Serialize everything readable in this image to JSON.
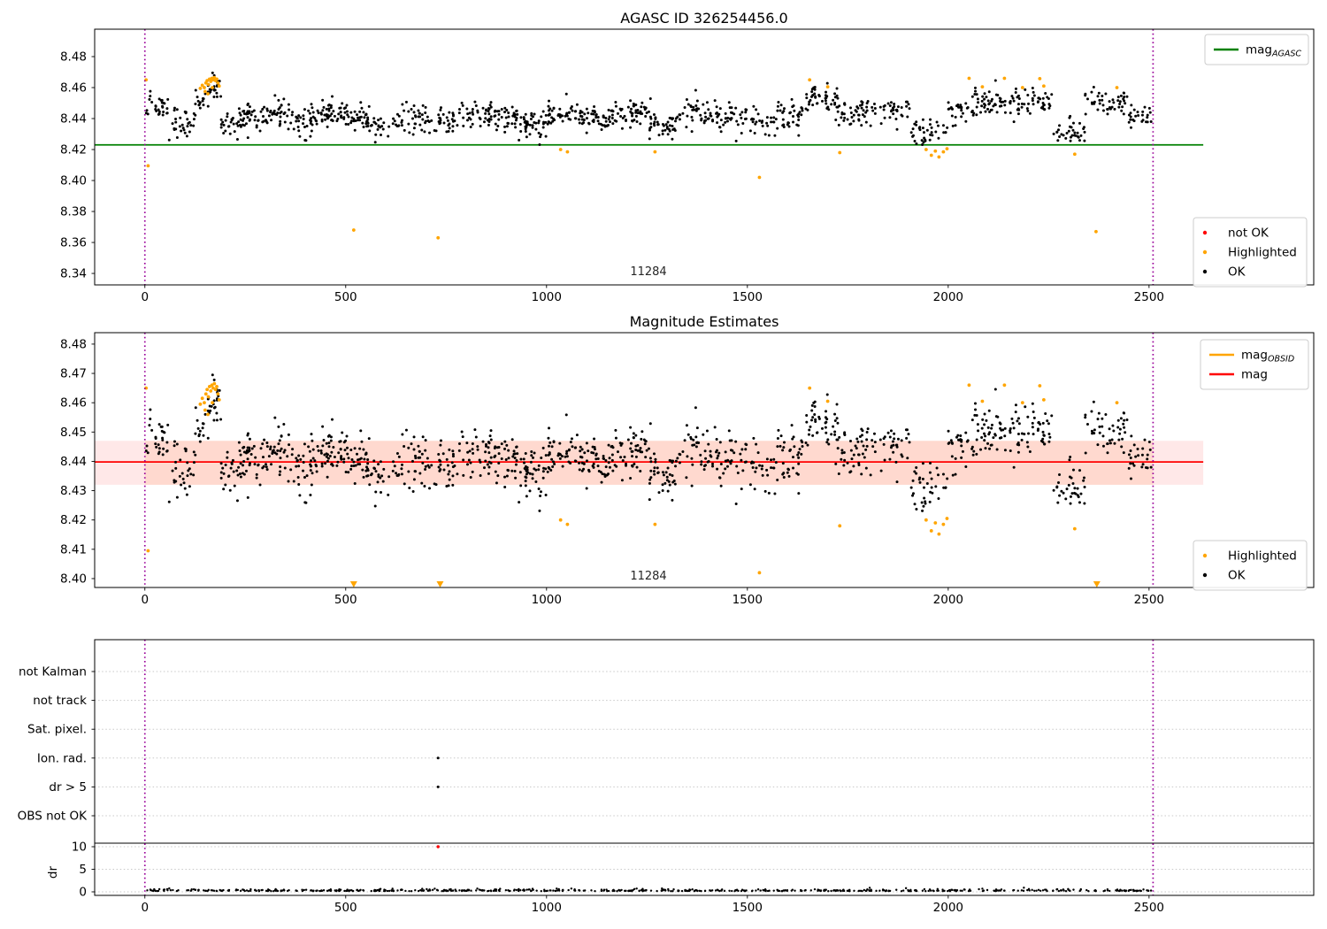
{
  "figure": {
    "background": "#ffffff"
  },
  "obsid_label": "11284",
  "colors": {
    "ok_marker": "#000000",
    "highlighted_marker": "#ffa500",
    "not_ok_marker": "#ff0000",
    "mag_agasc_line": "#008000",
    "mag_line": "#ff0000",
    "mag_band_fill": "#ff6666",
    "mag_band_inner_fill": "#ff8c50",
    "obsid_vline": "#990099",
    "grid_line": "#c8c8c8",
    "legend_border": "#cccccc"
  },
  "series_spec": {
    "seed": 1337,
    "n": 1300,
    "x_min": 2,
    "x_max": 2506,
    "noise_sd": 0.0045,
    "y_clamp": [
      8.417,
      8.4695
    ],
    "mean_profile": [
      [
        0,
        25,
        8.452
      ],
      [
        25,
        60,
        8.445
      ],
      [
        60,
        125,
        8.438
      ],
      [
        125,
        150,
        8.45
      ],
      [
        150,
        190,
        8.46
      ],
      [
        190,
        235,
        8.437
      ],
      [
        235,
        300,
        8.441
      ],
      [
        300,
        370,
        8.444
      ],
      [
        370,
        430,
        8.438
      ],
      [
        430,
        500,
        8.444
      ],
      [
        500,
        560,
        8.44
      ],
      [
        560,
        640,
        8.436
      ],
      [
        640,
        700,
        8.441
      ],
      [
        700,
        780,
        8.438
      ],
      [
        780,
        860,
        8.444
      ],
      [
        860,
        930,
        8.44
      ],
      [
        930,
        1000,
        8.436
      ],
      [
        1000,
        1080,
        8.443
      ],
      [
        1080,
        1160,
        8.44
      ],
      [
        1160,
        1250,
        8.443
      ],
      [
        1250,
        1330,
        8.437
      ],
      [
        1330,
        1420,
        8.444
      ],
      [
        1420,
        1500,
        8.44
      ],
      [
        1500,
        1575,
        8.437
      ],
      [
        1575,
        1640,
        8.442
      ],
      [
        1640,
        1725,
        8.452
      ],
      [
        1725,
        1810,
        8.443
      ],
      [
        1810,
        1905,
        8.446
      ],
      [
        1905,
        2000,
        8.432
      ],
      [
        2000,
        2065,
        8.446
      ],
      [
        2065,
        2260,
        8.451
      ],
      [
        2260,
        2340,
        8.431
      ],
      [
        2340,
        2450,
        8.451
      ],
      [
        2450,
        2506,
        8.441
      ]
    ]
  },
  "highlighted_points": [
    [
      138,
      8.4595
    ],
    [
      143,
      8.4615
    ],
    [
      148,
      8.46
    ],
    [
      150,
      8.4575
    ],
    [
      152,
      8.463
    ],
    [
      155,
      8.4645
    ],
    [
      157,
      8.456
    ],
    [
      158,
      8.462
    ],
    [
      161,
      8.4655
    ],
    [
      164,
      8.464
    ],
    [
      167,
      8.466
    ],
    [
      168,
      8.46
    ],
    [
      170,
      8.465
    ],
    [
      173,
      8.4665
    ],
    [
      176,
      8.4645
    ],
    [
      179,
      8.4655
    ],
    [
      182,
      8.463
    ],
    [
      185,
      8.461
    ],
    [
      3,
      8.465
    ],
    [
      8,
      8.4095
    ],
    [
      520,
      8.368
    ],
    [
      730,
      8.363
    ],
    [
      1035,
      8.42
    ],
    [
      1052,
      8.4185
    ],
    [
      1270,
      8.4185
    ],
    [
      1530,
      8.402
    ],
    [
      1655,
      8.465
    ],
    [
      1700,
      8.4605
    ],
    [
      1730,
      8.418
    ],
    [
      1945,
      8.42
    ],
    [
      1958,
      8.4163
    ],
    [
      1968,
      8.419
    ],
    [
      1977,
      8.4152
    ],
    [
      1988,
      8.4185
    ],
    [
      1997,
      8.4205
    ],
    [
      2052,
      8.466
    ],
    [
      2085,
      8.4605
    ],
    [
      2140,
      8.466
    ],
    [
      2185,
      8.46
    ],
    [
      2228,
      8.4658
    ],
    [
      2238,
      8.461
    ],
    [
      2315,
      8.417
    ],
    [
      2368,
      8.367
    ],
    [
      2420,
      8.46
    ]
  ],
  "chart_data": [
    {
      "type": "scatter",
      "title": "AGASC ID 326254456.0",
      "xlim": [
        -125,
        2910
      ],
      "ylim": [
        8.333,
        8.498
      ],
      "xticks": [
        0,
        500,
        1000,
        1500,
        2000,
        2500
      ],
      "ytick_values": [
        8.48,
        8.46,
        8.44,
        8.42,
        8.4,
        8.38,
        8.36,
        8.34
      ],
      "ytick_labels": [
        "8.48",
        "8.46",
        "8.44",
        "8.42",
        "8.40",
        "8.38",
        "8.36",
        "8.34"
      ],
      "ref_line": {
        "value": 8.423,
        "color": "#008000",
        "x_start": -125,
        "x_end": 2635
      },
      "obsid_vlines": {
        "xs": [
          0,
          2510
        ],
        "color": "#990099"
      },
      "obsid_text": "11284",
      "legend_top": [
        {
          "marker": "line",
          "color": "#008000",
          "label": "mag",
          "sub": "AGASC"
        }
      ],
      "legend_bottom": [
        {
          "marker": "dot",
          "color": "#ff0000",
          "label": "not OK"
        },
        {
          "marker": "dot",
          "color": "#ffa500",
          "label": "Highlighted"
        },
        {
          "marker": "dot",
          "color": "#000000",
          "label": "OK"
        }
      ]
    },
    {
      "type": "scatter",
      "title": "Magnitude Estimates",
      "xlim": [
        -125,
        2910
      ],
      "ylim": [
        8.397,
        8.484
      ],
      "xticks": [
        0,
        500,
        1000,
        1500,
        2000,
        2500
      ],
      "ytick_values": [
        8.48,
        8.47,
        8.46,
        8.45,
        8.44,
        8.43,
        8.42,
        8.41,
        8.4
      ],
      "ytick_labels": [
        "8.48",
        "8.47",
        "8.46",
        "8.45",
        "8.44",
        "8.43",
        "8.42",
        "8.41",
        "8.40"
      ],
      "ref_line": {
        "value": 8.4398,
        "color": "#ff0000",
        "x_start": -125,
        "x_end": 2635
      },
      "band": {
        "lo": 8.432,
        "hi": 8.447,
        "x_start": -125,
        "x_end": 2635,
        "inner_x": [
          0,
          2510
        ]
      },
      "obsid_vlines": {
        "xs": [
          0,
          2510
        ],
        "color": "#990099"
      },
      "obsid_text": "11284",
      "clipped_below_x": [
        520,
        735,
        2370
      ],
      "legend_top": [
        {
          "marker": "line",
          "color": "#ffa500",
          "label": "mag",
          "sub": "OBSID"
        },
        {
          "marker": "line",
          "color": "#ff0000",
          "label": "mag"
        }
      ],
      "legend_bottom": [
        {
          "marker": "dot",
          "color": "#ffa500",
          "label": "Highlighted"
        },
        {
          "marker": "dot",
          "color": "#000000",
          "label": "OK"
        }
      ]
    },
    {
      "type": "flags",
      "ylabel": "dr",
      "flag_rows": [
        "not Kalman",
        "not track",
        "Sat. pixel.",
        "Ion. rad.",
        "dr > 5",
        "OBS not OK"
      ],
      "dr_ticks": [
        10,
        5,
        0
      ],
      "xticks": [
        0,
        500,
        1000,
        1500,
        2000,
        2500
      ],
      "flag_points": [
        {
          "row": "Ion. rad.",
          "x": 730,
          "color": "#000000"
        },
        {
          "row": "dr > 5",
          "x": 730,
          "color": "#000000"
        }
      ],
      "dr_outliers": [
        {
          "x": 730,
          "value": 10,
          "color": "#ff0000"
        }
      ],
      "dr_series_spec": {
        "seed": 777,
        "n": 640,
        "x_min": 2,
        "x_max": 2506,
        "base": 0.15,
        "spread": 0.2
      },
      "obsid_vlines": {
        "xs": [
          0,
          2510
        ],
        "color": "#990099"
      }
    }
  ]
}
